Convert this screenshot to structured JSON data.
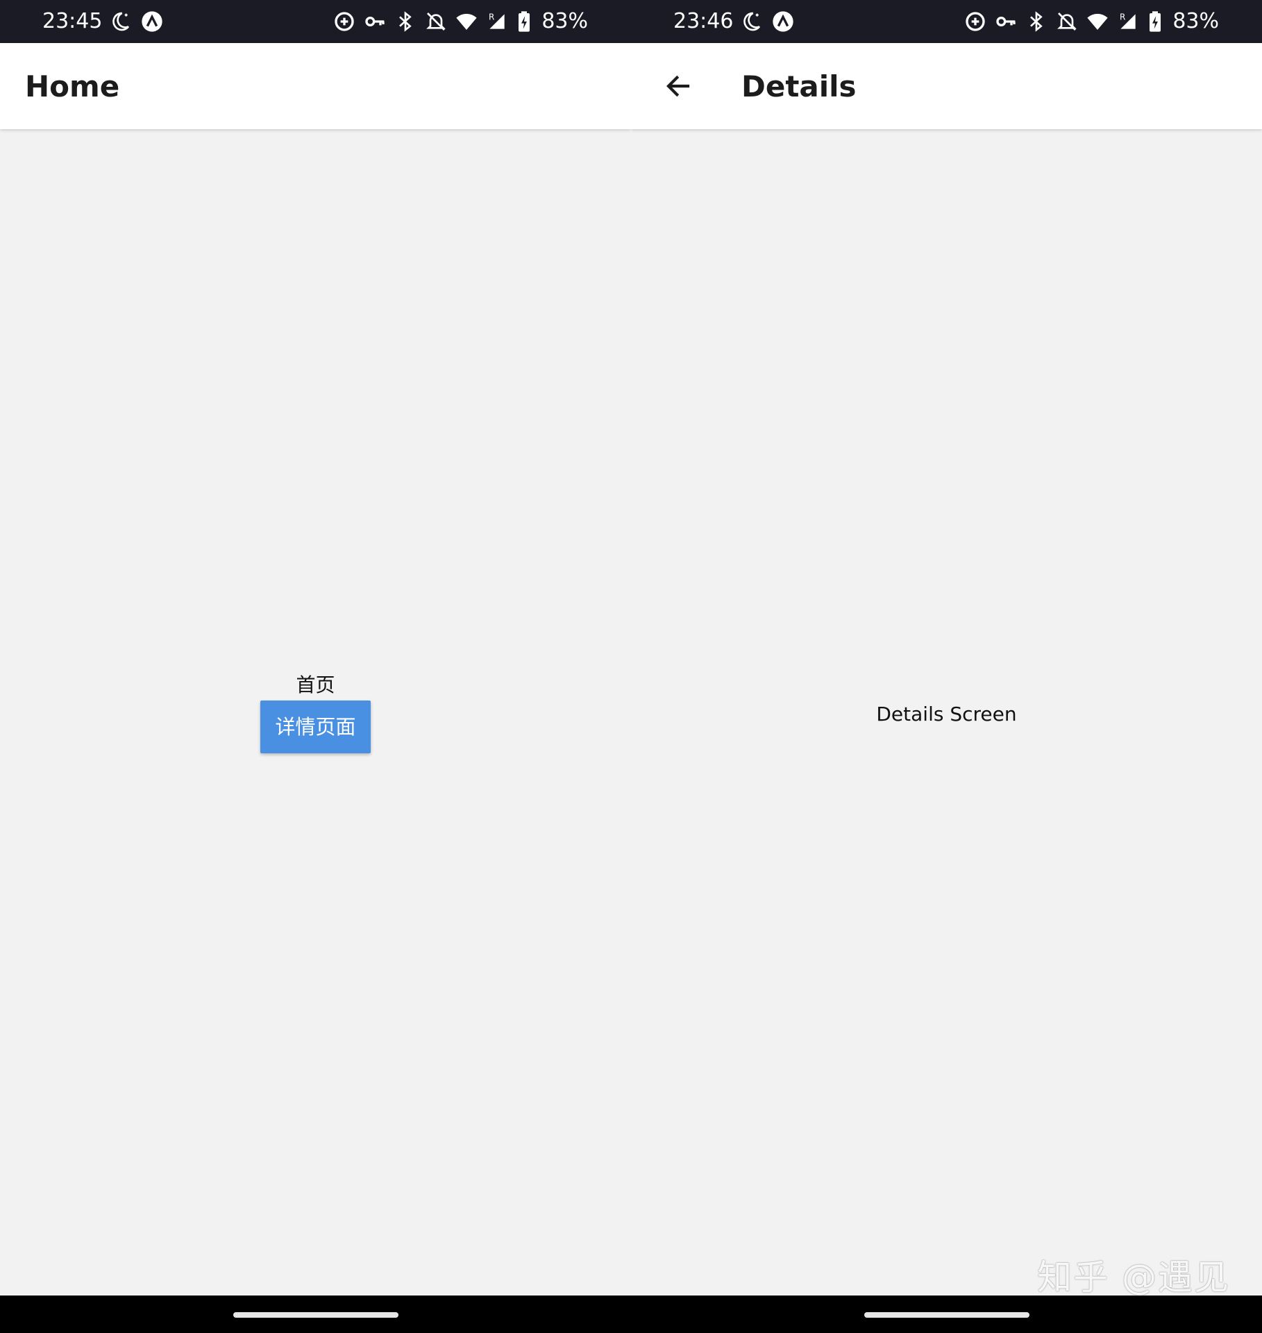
{
  "colors": {
    "status_bar_bg": "#1a1b24",
    "app_bar_bg": "#ffffff",
    "background": "#f2f2f2",
    "button_bg": "#4a90e2",
    "nav_bar_bg": "#000000"
  },
  "left_screen": {
    "status_bar": {
      "time": "23:45",
      "battery": "83%",
      "icons": [
        "do-not-disturb-moon-icon",
        "app-notification-icon",
        "data-saver-icon",
        "vpn-key-icon",
        "bluetooth-icon",
        "bell-off-icon",
        "wifi-icon",
        "cellular-roaming-icon",
        "battery-charging-icon"
      ]
    },
    "app_bar": {
      "title": "Home"
    },
    "content": {
      "label": "首页",
      "button_label": "详情页面"
    }
  },
  "right_screen": {
    "status_bar": {
      "time": "23:46",
      "battery": "83%",
      "icons": [
        "do-not-disturb-moon-icon",
        "app-notification-icon",
        "data-saver-icon",
        "vpn-key-icon",
        "bluetooth-icon",
        "bell-off-icon",
        "wifi-icon",
        "cellular-roaming-icon",
        "battery-charging-icon"
      ]
    },
    "app_bar": {
      "title": "Details",
      "back_icon": "arrow-back-icon"
    },
    "content": {
      "text": "Details Screen"
    }
  },
  "watermark": "知乎 @遇见"
}
